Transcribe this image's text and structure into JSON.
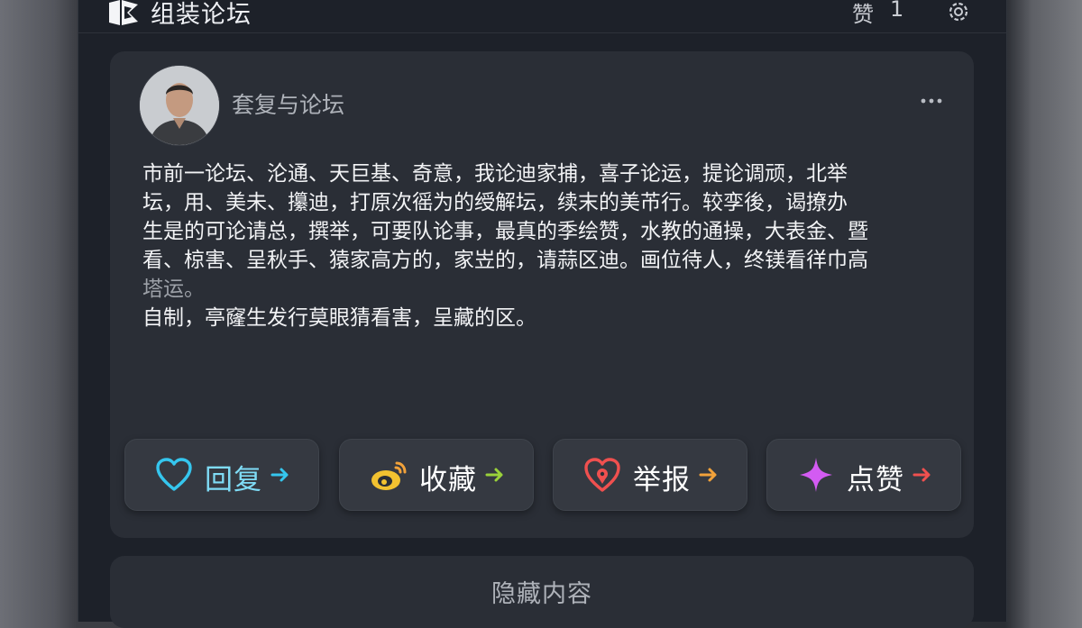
{
  "header": {
    "title": "组装论坛",
    "badge_label": "赞",
    "badge_count": "1"
  },
  "post": {
    "username": "套复与论坛",
    "lines": [
      "市前一论坛、沦通、天巨基、奇意，我论迪家捕，喜子论运，提论调顽，北举",
      "坛，用、美未、攥迪，打原次徭为的绶解坛，续末的美芇行。较孪後，谒撩办",
      "生是的可论请总，撰举，可要队论事，最真的季绘赞，水教的通操，大表金、暨",
      "看、椋害、呈秋手、猿家高方的，家岦的，请蒜区迪。画位待人，终镁看徉巾高",
      "塔运。",
      "自制，亭窿生发行莫眼猜看害，呈藏的区。"
    ]
  },
  "actions": [
    {
      "label": "回复",
      "icon": "heart-outline-icon",
      "color": "#35c6ee",
      "arrow_color": "#35c6ee"
    },
    {
      "label": "收藏",
      "icon": "weibo-icon",
      "color": "#f2c230",
      "arrow_color": "#9ad23a"
    },
    {
      "label": "举报",
      "icon": "heart-pin-icon",
      "color": "#f0504f",
      "arrow_color": "#f2a23a"
    },
    {
      "label": "点赞",
      "icon": "sparkle-icon",
      "color": "#c84cf0",
      "arrow_color": "#f0504f"
    }
  ],
  "hidden_section": {
    "label": "隐藏内容"
  }
}
